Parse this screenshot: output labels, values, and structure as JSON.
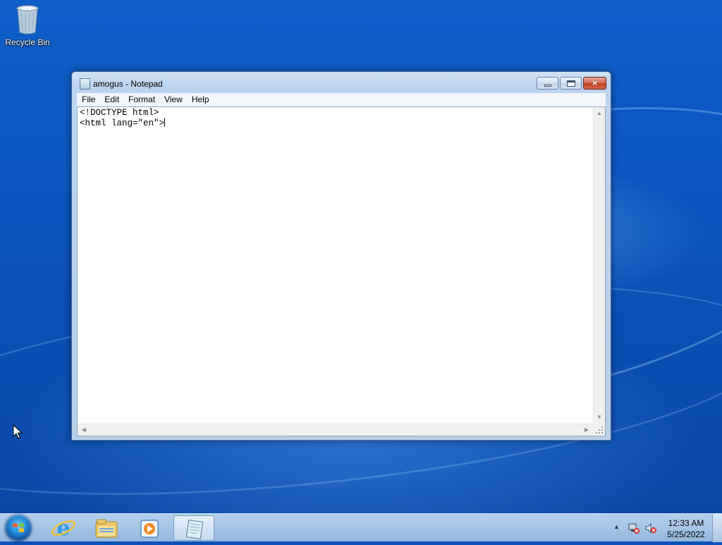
{
  "desktop": {
    "icons": [
      {
        "label": "Recycle Bin",
        "icon": "recycle-bin-icon"
      }
    ]
  },
  "window": {
    "title": "amogus - Notepad",
    "app_icon": "notepad-icon",
    "controls": {
      "minimize": "minimize-icon",
      "maximize": "maximize-icon",
      "close": "×"
    },
    "menu": [
      "File",
      "Edit",
      "Format",
      "View",
      "Help"
    ],
    "content_lines": [
      "<!DOCTYPE html>",
      "<html lang=\"en\">"
    ]
  },
  "taskbar": {
    "start": "windows-start-icon",
    "pinned": [
      {
        "name": "internet-explorer-icon",
        "active": false
      },
      {
        "name": "file-explorer-icon",
        "active": false
      },
      {
        "name": "windows-media-player-icon",
        "active": false
      },
      {
        "name": "notepad-icon",
        "active": true
      }
    ],
    "tray": {
      "icons": [
        "show-hidden-icons-icon",
        "network-error-icon",
        "volume-muted-icon"
      ],
      "time": "12:33 AM",
      "date": "5/25/2022"
    }
  },
  "colors": {
    "desktop_blue": "#0d50b8",
    "taskbar": "#a9c6e6",
    "close_red": "#c2401f"
  }
}
